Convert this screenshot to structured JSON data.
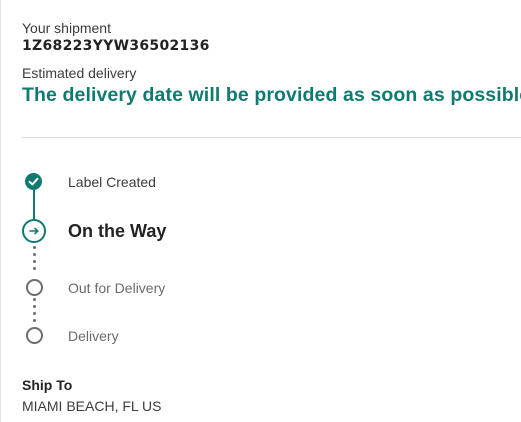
{
  "shipment": {
    "label": "Your shipment",
    "tracking_number": "1Z68223YYW36502136"
  },
  "estimate": {
    "label": "Estimated delivery",
    "message": "The delivery date will be provided as soon as possible."
  },
  "progress": {
    "steps": [
      {
        "label": "Label Created",
        "status": "completed",
        "icon": "check-icon"
      },
      {
        "label": "On the Way",
        "status": "current",
        "icon": "arrow-right-icon"
      },
      {
        "label": "Out for Delivery",
        "status": "pending",
        "icon": "empty-circle-icon"
      },
      {
        "label": "Delivery",
        "status": "pending",
        "icon": "empty-circle-icon"
      }
    ]
  },
  "ship_to": {
    "label": "Ship To",
    "value": "MIAMI BEACH, FL US"
  },
  "colors": {
    "accent": "#0f7a6f",
    "pending": "#6e6e6e",
    "text": "#232323"
  }
}
